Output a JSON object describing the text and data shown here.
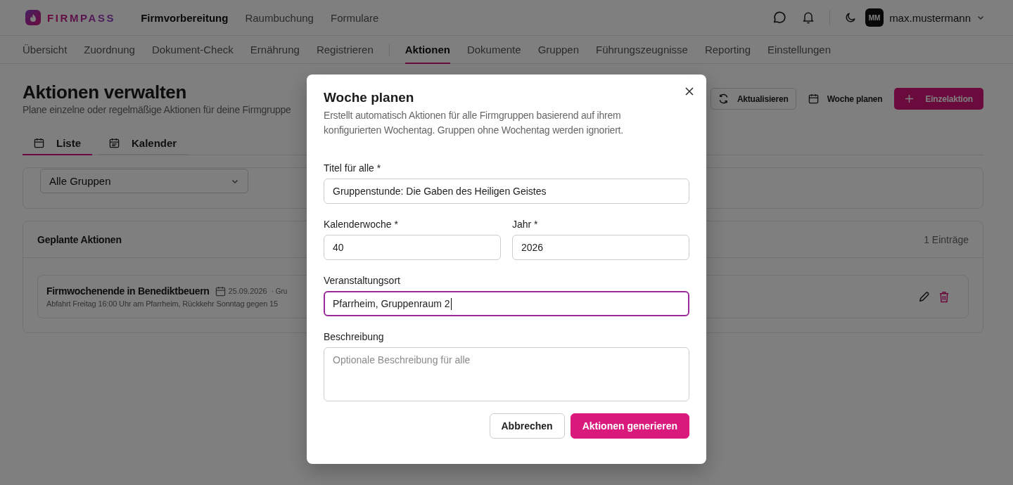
{
  "header": {
    "brand": "FIRMPASS",
    "nav": [
      {
        "label": "Firmvorbereitung",
        "selected": true
      },
      {
        "label": "Raumbuchung",
        "selected": false
      },
      {
        "label": "Formulare",
        "selected": false
      }
    ],
    "user": {
      "initials": "MM",
      "name": "max.mustermann"
    }
  },
  "subnav": {
    "groups": [
      [
        {
          "label": "Übersicht",
          "selected": false
        },
        {
          "label": "Zuordnung",
          "selected": false
        },
        {
          "label": "Dokument-Check",
          "selected": false
        },
        {
          "label": "Ernährung",
          "selected": false
        },
        {
          "label": "Registrieren",
          "selected": false
        }
      ],
      [
        {
          "label": "Aktionen",
          "selected": true
        },
        {
          "label": "Dokumente",
          "selected": false
        },
        {
          "label": "Gruppen",
          "selected": false
        },
        {
          "label": "Führungszeugnisse",
          "selected": false
        },
        {
          "label": "Reporting",
          "selected": false
        },
        {
          "label": "Einstellungen",
          "selected": false
        }
      ]
    ]
  },
  "page": {
    "title": "Aktionen verwalten",
    "subtitle": "Plane einzelne oder regelmäßige Aktionen für deine Firmgruppe",
    "actions": [
      {
        "label": "Aktualisieren",
        "kind": "outline"
      },
      {
        "label": "Woche planen",
        "kind": "ghost"
      },
      {
        "label": "Einzelaktion",
        "kind": "primary"
      }
    ],
    "view_tabs": [
      {
        "label": "Liste",
        "selected": true
      },
      {
        "label": "Kalender",
        "selected": false
      }
    ],
    "filter": {
      "value": "Alle Gruppen"
    },
    "list": {
      "title": "Geplante Aktionen",
      "count": "1 Einträge",
      "items": [
        {
          "title": "Firmwochenende in Benediktbeuern",
          "date": "25.09.2026",
          "meta": "· Gru",
          "description": "Abfahrt Freitag 16:00 Uhr am Pfarrheim, Rückkehr Sonntag gegen 15"
        }
      ]
    }
  },
  "dialog": {
    "title": "Woche planen",
    "description": "Erstellt automatisch Aktionen für alle Firmgruppen basierend auf ihrem konfigurierten Wochentag. Gruppen ohne Wochentag werden ignoriert.",
    "rows": [
      [
        {
          "label": "Titel für alle *",
          "kind": "input",
          "value": "Gruppenstunde: Die Gaben des Heiligen Geistes",
          "focused": false
        }
      ],
      [
        {
          "label": "Kalenderwoche *",
          "kind": "input",
          "value": "40",
          "focused": false
        },
        {
          "label": "Jahr *",
          "kind": "input",
          "value": "2026",
          "focused": false
        }
      ],
      [
        {
          "label": "Veranstaltungsort",
          "kind": "input",
          "value": "Pfarrheim, Gruppenraum 2",
          "focused": true
        }
      ],
      [
        {
          "label": "Beschreibung",
          "kind": "textarea",
          "placeholder": "Optionale Beschreibung für alle",
          "focused": false
        }
      ]
    ],
    "buttons": [
      {
        "label": "Abbrechen",
        "kind": "secondary"
      },
      {
        "label": "Aktionen generieren",
        "kind": "primary"
      }
    ]
  }
}
